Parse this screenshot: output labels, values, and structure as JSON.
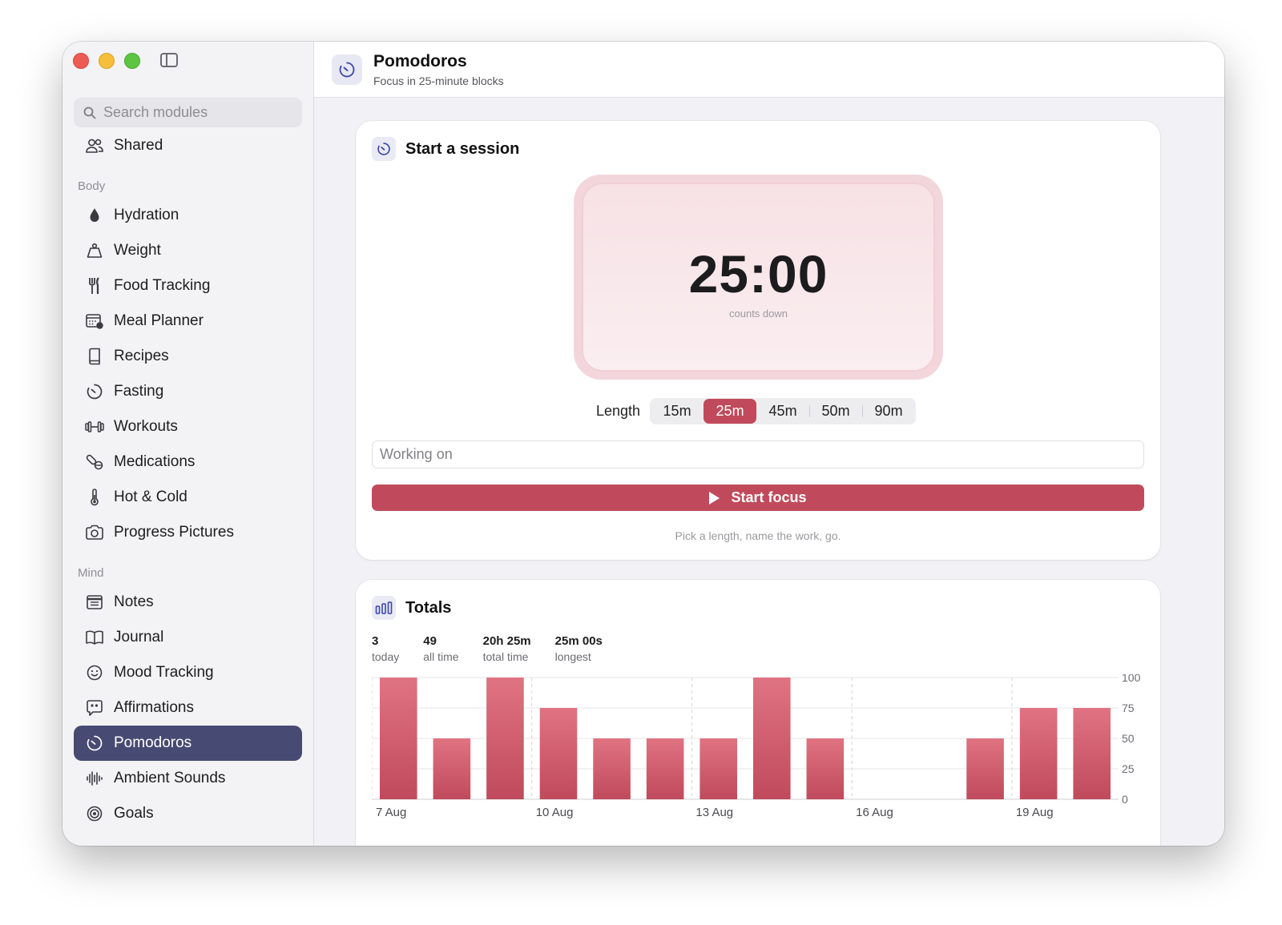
{
  "search": {
    "placeholder": "Search modules"
  },
  "sidebar": {
    "shared": {
      "label": "Shared",
      "icon": "people-icon"
    },
    "sections": [
      {
        "label": "Body",
        "items": [
          {
            "label": "Hydration",
            "icon": "drop-icon"
          },
          {
            "label": "Weight",
            "icon": "weight-icon"
          },
          {
            "label": "Food Tracking",
            "icon": "fork-knife-icon"
          },
          {
            "label": "Meal Planner",
            "icon": "calendar-icon"
          },
          {
            "label": "Recipes",
            "icon": "book-icon"
          },
          {
            "label": "Fasting",
            "icon": "timer-icon"
          },
          {
            "label": "Workouts",
            "icon": "dumbbell-icon"
          },
          {
            "label": "Medications",
            "icon": "pills-icon"
          },
          {
            "label": "Hot & Cold",
            "icon": "thermometer-icon"
          },
          {
            "label": "Progress Pictures",
            "icon": "camera-icon"
          }
        ]
      },
      {
        "label": "Mind",
        "items": [
          {
            "label": "Notes",
            "icon": "notes-icon"
          },
          {
            "label": "Journal",
            "icon": "open-book-icon"
          },
          {
            "label": "Mood Tracking",
            "icon": "smile-icon"
          },
          {
            "label": "Affirmations",
            "icon": "quote-bubble-icon"
          },
          {
            "label": "Pomodoros",
            "icon": "timer-icon",
            "active": true
          },
          {
            "label": "Ambient Sounds",
            "icon": "waveform-icon"
          },
          {
            "label": "Goals",
            "icon": "target-icon"
          }
        ]
      }
    ]
  },
  "header": {
    "title": "Pomodoros",
    "subtitle": "Focus in 25-minute blocks",
    "icon": "timer-icon"
  },
  "session": {
    "title": "Start a session",
    "timer": "25:00",
    "timer_caption": "counts down",
    "length_label": "Length",
    "lengths": [
      "15m",
      "25m",
      "45m",
      "50m",
      "90m"
    ],
    "selected_length": "25m",
    "input_placeholder": "Working on",
    "start_label": "Start focus",
    "hint": "Pick a length, name the work, go."
  },
  "totals": {
    "title": "Totals",
    "stats": [
      {
        "value": "3",
        "label": "today"
      },
      {
        "value": "49",
        "label": "all time"
      },
      {
        "value": "20h 25m",
        "label": "total time"
      },
      {
        "value": "25m 00s",
        "label": "longest"
      }
    ]
  },
  "colors": {
    "accent": "#c04a5b",
    "sidebar_active": "#474a72",
    "bar_top": "#e07382",
    "bar_bottom": "#c04a5b"
  },
  "chart_data": {
    "type": "bar",
    "categories": [
      "7 Aug",
      "8 Aug",
      "9 Aug",
      "10 Aug",
      "11 Aug",
      "12 Aug",
      "13 Aug",
      "14 Aug",
      "15 Aug",
      "16 Aug",
      "17 Aug",
      "18 Aug",
      "19 Aug",
      "20 Aug"
    ],
    "values": [
      100,
      50,
      100,
      75,
      50,
      50,
      50,
      100,
      50,
      0,
      0,
      50,
      75,
      75
    ],
    "x_tick_labels": [
      "7 Aug",
      "10 Aug",
      "13 Aug",
      "16 Aug",
      "19 Aug"
    ],
    "y_ticks": [
      0,
      25,
      50,
      75,
      100
    ],
    "ylim": [
      0,
      100
    ],
    "y_axis_side": "right",
    "grid": true
  }
}
